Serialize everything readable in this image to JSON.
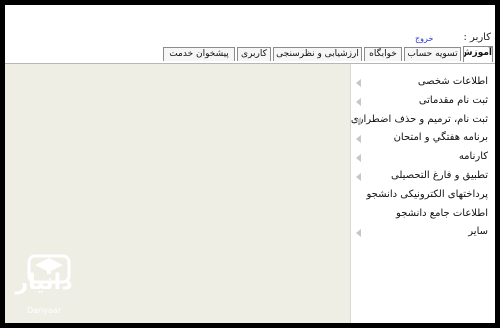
{
  "header": {
    "user_label": "کاربر :",
    "logout_label": "خروج"
  },
  "tabs": [
    {
      "label": "آموزش",
      "active": true
    },
    {
      "label": "تسویه حساب",
      "active": false
    },
    {
      "label": "خوابگاه",
      "active": false
    },
    {
      "label": "ارزشیابی و نظرسنجی",
      "active": false
    },
    {
      "label": "کاربری",
      "active": false
    },
    {
      "label": "پیشخوان خدمت",
      "active": false
    }
  ],
  "menu": {
    "items": [
      {
        "label": "اطلاعات شخصی",
        "has_submenu": true
      },
      {
        "label": "ثبت نام مقدماتی",
        "has_submenu": true
      },
      {
        "label": "ثبت نام، ترمیم و حذف اضطراری",
        "has_submenu": true
      },
      {
        "label": "برنامه هفتگي و امتحان",
        "has_submenu": true
      },
      {
        "label": "كارنامه",
        "has_submenu": true
      },
      {
        "label": "تطبیق و فارغ التحصیلی",
        "has_submenu": true
      },
      {
        "label": "پرداختهای الكترونیكی دانشجو",
        "has_submenu": false
      },
      {
        "label": "اطلاعات جامع دانشجو",
        "has_submenu": false
      },
      {
        "label": "سایر",
        "has_submenu": true
      }
    ]
  },
  "watermark": {
    "brand": "دانیار",
    "brand_latin": "Danyaar"
  },
  "colors": {
    "content_bg": "#eeeee5",
    "link": "#2a3dd8",
    "arrow": "#c6c6c6"
  }
}
